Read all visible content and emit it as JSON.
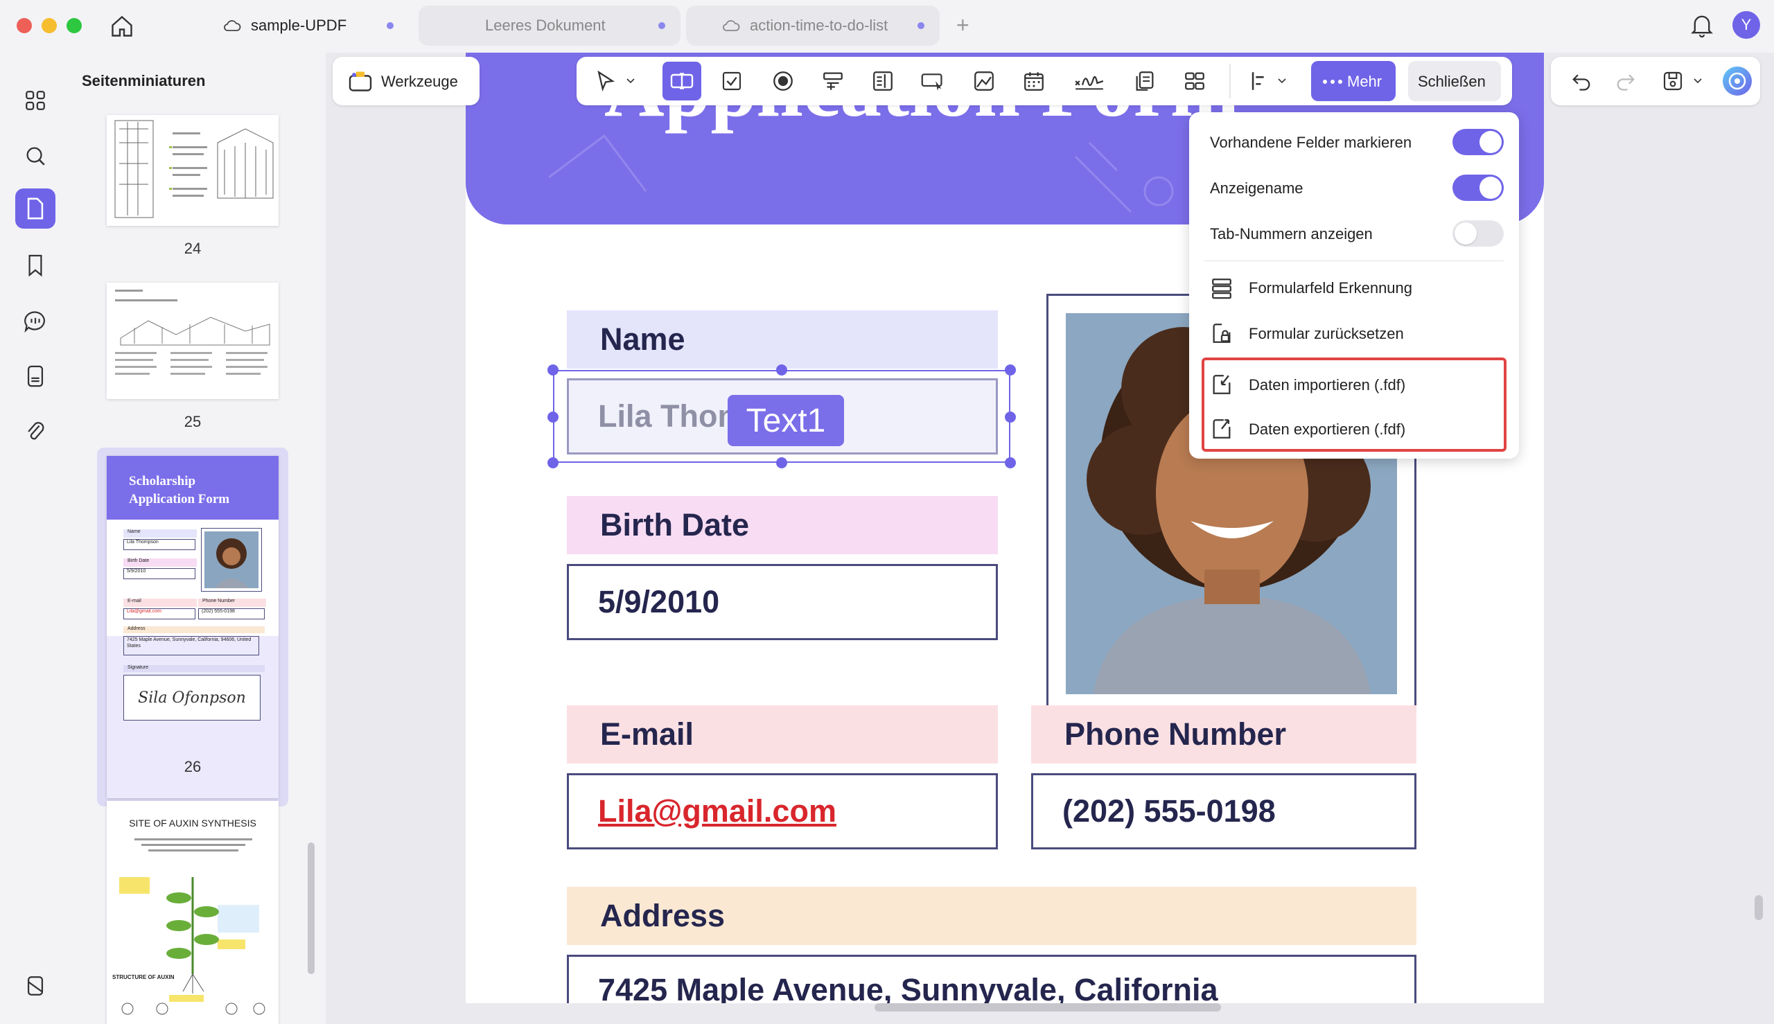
{
  "tabs": [
    {
      "label": "sample-UPDF",
      "active": true
    },
    {
      "label": "Leeres Dokument",
      "active": false
    },
    {
      "label": "action-time-to-do-list",
      "active": false
    }
  ],
  "user_avatar": "Y",
  "sidebar": {
    "title": "Seitenminiaturen",
    "page_numbers": [
      "24",
      "25",
      "26"
    ],
    "thumb26": {
      "title_line1": "Scholarship",
      "title_line2": "Application Form",
      "name_label": "Name",
      "name_value": "Lila Thompson",
      "birth_label": "Birth Date",
      "birth_value": "5/9/2010",
      "email_label": "E-mail",
      "email_value": "Lila@gmail.com",
      "phone_label": "Phone Number",
      "phone_value": "(202) 555-0198",
      "address_label": "Address",
      "address_value": "7425 Maple Avenue, Sunnyvale, California, 94606, United States",
      "signature_label": "Signature",
      "signature_value": "Sila Ofonpson"
    },
    "thumb27_title": "SITE OF AUXIN SYNTHESIS",
    "thumb27_sub": "STRUCTURE OF AUXIN"
  },
  "toolbar": {
    "tools_label": "Werkzeuge",
    "more_label": "Mehr",
    "close_label": "Schließen"
  },
  "document": {
    "header_title": "Application Form",
    "name_label": "Name",
    "name_value": "Lila Thom",
    "field_tag": "Text1",
    "birth_label": "Birth Date",
    "birth_value": "5/9/2010",
    "email_label": "E-mail",
    "email_value": "Lila@gmail.com",
    "phone_label": "Phone Number",
    "phone_value": "(202) 555-0198",
    "address_label": "Address",
    "address_value": "7425 Maple Avenue, Sunnyvale, California"
  },
  "menu": {
    "items": [
      {
        "label": "Vorhandene Felder markieren",
        "toggle": true
      },
      {
        "label": "Anzeigename",
        "toggle": true
      },
      {
        "label": "Tab-Nummern anzeigen",
        "toggle": false
      },
      {
        "label": "Formularfeld Erkennung"
      },
      {
        "label": "Formular zurücksetzen"
      },
      {
        "label": "Daten importieren (.fdf)"
      },
      {
        "label": "Daten exportieren (.fdf)"
      }
    ]
  },
  "colors": {
    "accent": "#6f64e8",
    "header_purple": "#7b6ee9",
    "highlight_red": "#e14444",
    "link_red": "#d8262c"
  }
}
